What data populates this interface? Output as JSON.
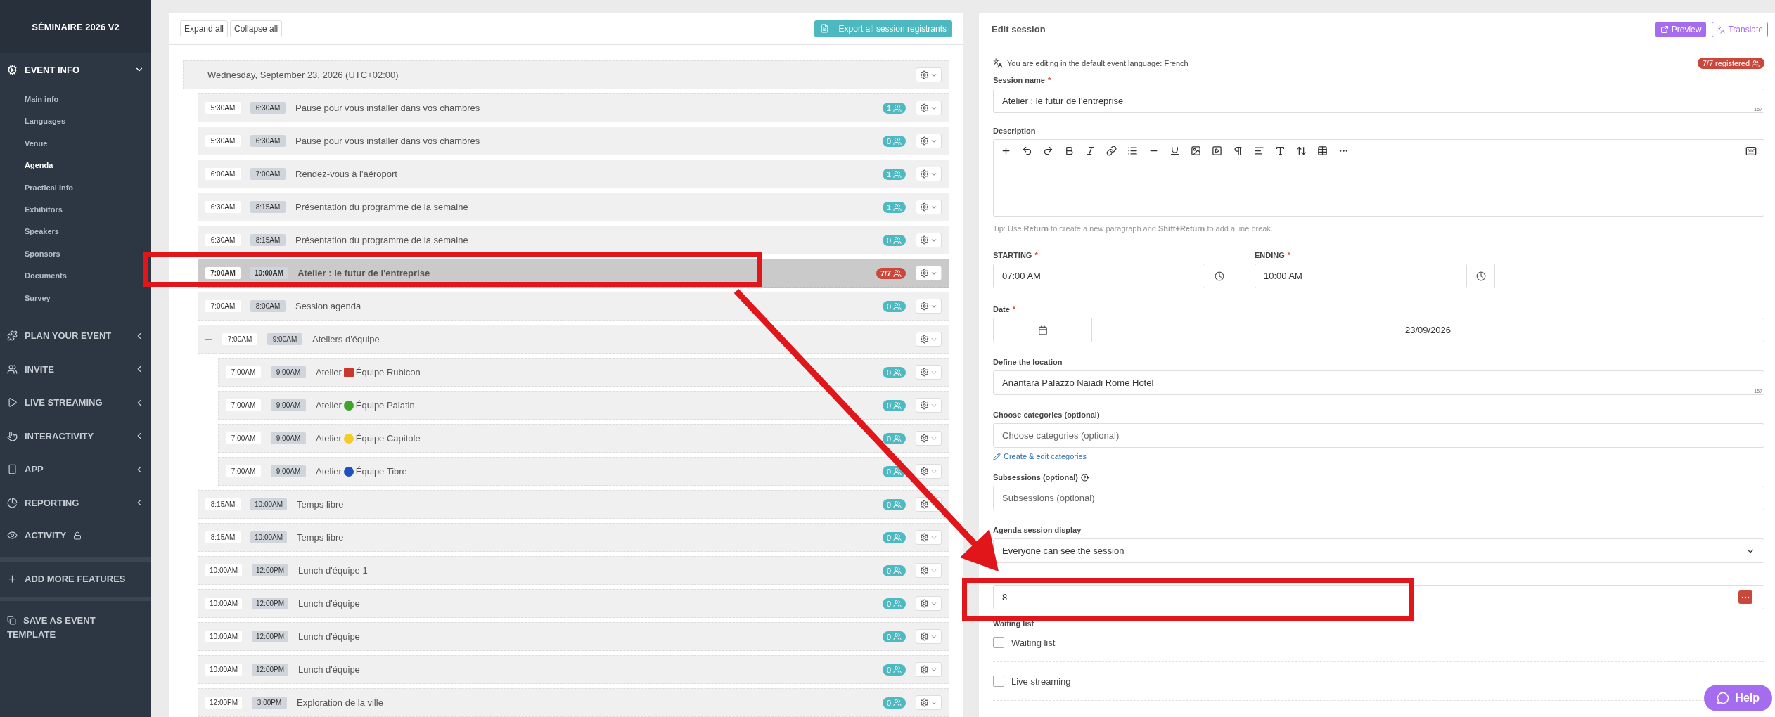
{
  "sidebar": {
    "title": "SÉMINAIRE 2026 V2",
    "sections": [
      {
        "label": "EVENT INFO",
        "expanded": true,
        "children": [
          {
            "label": "Main info",
            "selected": false
          },
          {
            "label": "Languages",
            "selected": false
          },
          {
            "label": "Venue",
            "selected": false
          },
          {
            "label": "Agenda",
            "selected": true
          },
          {
            "label": "Practical Info",
            "selected": false
          },
          {
            "label": "Exhibitors",
            "selected": false
          },
          {
            "label": "Speakers",
            "selected": false
          },
          {
            "label": "Sponsors",
            "selected": false
          },
          {
            "label": "Documents",
            "selected": false
          },
          {
            "label": "Survey",
            "selected": false
          }
        ]
      },
      {
        "label": "PLAN YOUR EVENT",
        "expanded": false
      },
      {
        "label": "INVITE",
        "expanded": false
      },
      {
        "label": "LIVE STREAMING",
        "expanded": false
      },
      {
        "label": "INTERACTIVITY",
        "expanded": false
      },
      {
        "label": "APP",
        "expanded": false
      },
      {
        "label": "REPORTING",
        "expanded": false
      }
    ],
    "activity": {
      "label": "ACTIVITY",
      "locked": true
    },
    "add_features": "ADD MORE FEATURES",
    "save_template": "SAVE AS EVENT TEMPLATE"
  },
  "agenda": {
    "expand_all": "Expand all",
    "collapse_all": "Collapse all",
    "export": "Export all session registrants",
    "day": {
      "label": "Wednesday, September 23, 2026 (UTC+02:00)",
      "expanded": true
    },
    "sessions": [
      {
        "start": "5:30AM",
        "end": "6:30AM",
        "title": "Pause pour vous installer dans vos chambres",
        "count": "1",
        "full": false,
        "selected": false
      },
      {
        "start": "5:30AM",
        "end": "6:30AM",
        "title": "Pause pour vous installer dans vos chambres",
        "count": "0",
        "full": false,
        "selected": false
      },
      {
        "start": "6:00AM",
        "end": "7:00AM",
        "title": "Rendez-vous à l'aéroport",
        "count": "1",
        "full": false,
        "selected": false
      },
      {
        "start": "6:30AM",
        "end": "8:15AM",
        "title": "Présentation du programme de la semaine",
        "count": "1",
        "full": false,
        "selected": false
      },
      {
        "start": "6:30AM",
        "end": "8:15AM",
        "title": "Présentation du programme de la semaine",
        "count": "0",
        "full": false,
        "selected": false
      },
      {
        "start": "7:00AM",
        "end": "10:00AM",
        "title": "Atelier : le futur de l'entreprise",
        "count": "7/7",
        "full": true,
        "selected": true
      },
      {
        "start": "7:00AM",
        "end": "8:00AM",
        "title": "Session agenda",
        "count": "0",
        "full": false,
        "selected": false
      },
      {
        "start": "7:00AM",
        "end": "9:00AM",
        "title": "Ateliers d'équipe",
        "selected": false,
        "expanded": true,
        "children": [
          {
            "start": "7:00AM",
            "end": "9:00AM",
            "title": "Atelier",
            "marker": {
              "kind": "square",
              "color": "#c8372b"
            },
            "title_after": "Équipe Rubicon",
            "count": "0",
            "full": false,
            "selected": false
          },
          {
            "start": "7:00AM",
            "end": "9:00AM",
            "title": "Atelier",
            "marker": {
              "kind": "circle",
              "color": "#3fa52a"
            },
            "title_after": "Équipe Palatin",
            "count": "0",
            "full": false,
            "selected": false
          },
          {
            "start": "7:00AM",
            "end": "9:00AM",
            "title": "Atelier",
            "marker": {
              "kind": "circle",
              "color": "#f5cc26"
            },
            "title_after": "Équipe Capitole",
            "count": "0",
            "full": false,
            "selected": false
          },
          {
            "start": "7:00AM",
            "end": "9:00AM",
            "title": "Atelier",
            "marker": {
              "kind": "circle",
              "color": "#2050c0"
            },
            "title_after": "Équipe Tibre",
            "count": "0",
            "full": false,
            "selected": false
          }
        ]
      },
      {
        "start": "8:15AM",
        "end": "10:00AM",
        "title": "Temps libre",
        "count": "0",
        "full": false,
        "selected": false
      },
      {
        "start": "8:15AM",
        "end": "10:00AM",
        "title": "Temps libre",
        "count": "0",
        "full": false,
        "selected": false
      },
      {
        "start": "10:00AM",
        "end": "12:00PM",
        "title": "Lunch d'équipe 1",
        "count": "0",
        "full": false,
        "selected": false
      },
      {
        "start": "10:00AM",
        "end": "12:00PM",
        "title": "Lunch d'équipe",
        "count": "0",
        "full": false,
        "selected": false
      },
      {
        "start": "10:00AM",
        "end": "12:00PM",
        "title": "Lunch d'équipe",
        "count": "0",
        "full": false,
        "selected": false
      },
      {
        "start": "10:00AM",
        "end": "12:00PM",
        "title": "Lunch d'équipe",
        "count": "0",
        "full": false,
        "selected": false
      },
      {
        "start": "12:00PM",
        "end": "3:00PM",
        "title": "Exploration de la ville",
        "count": "0",
        "full": false,
        "selected": false
      }
    ]
  },
  "editor": {
    "title": "Edit session",
    "preview": "Preview",
    "translate": "Translate",
    "language_note": "You are editing in the default event language: French",
    "registered": "7/7 registered",
    "session_name": {
      "label": "Session name",
      "required": "*",
      "value": "Atelier : le futur de l'entreprise",
      "counter": "157"
    },
    "description": {
      "label": "Description",
      "tip": "Tip: Use **Return** to create a new paragraph and **Shift+Return** to add a line break."
    },
    "starting": {
      "label": "STARTING",
      "required": "*",
      "value": "07:00 AM"
    },
    "ending": {
      "label": "ENDING",
      "required": "*",
      "value": "10:00 AM"
    },
    "date": {
      "label": "Date",
      "required": "*",
      "value": "23/09/2026"
    },
    "location": {
      "label": "Define the location",
      "value": "Anantara Palazzo Naiadi Rome Hotel",
      "counter": "157"
    },
    "categories": {
      "label": "Choose categories (optional)",
      "placeholder": "Choose categories (optional)",
      "link": "Create & edit categories"
    },
    "subsessions": {
      "label": "Subsessions (optional)",
      "placeholder": "Subsessions (optional)"
    },
    "display": {
      "label": "Agenda session display",
      "value": "Everyone can see the session"
    },
    "capacity": {
      "value": "8"
    },
    "waiting_list": {
      "label": "Waiting list",
      "option": "Waiting list",
      "checked": false
    },
    "live_streaming": {
      "label": "Live streaming",
      "checked": false
    }
  },
  "help": "Help"
}
